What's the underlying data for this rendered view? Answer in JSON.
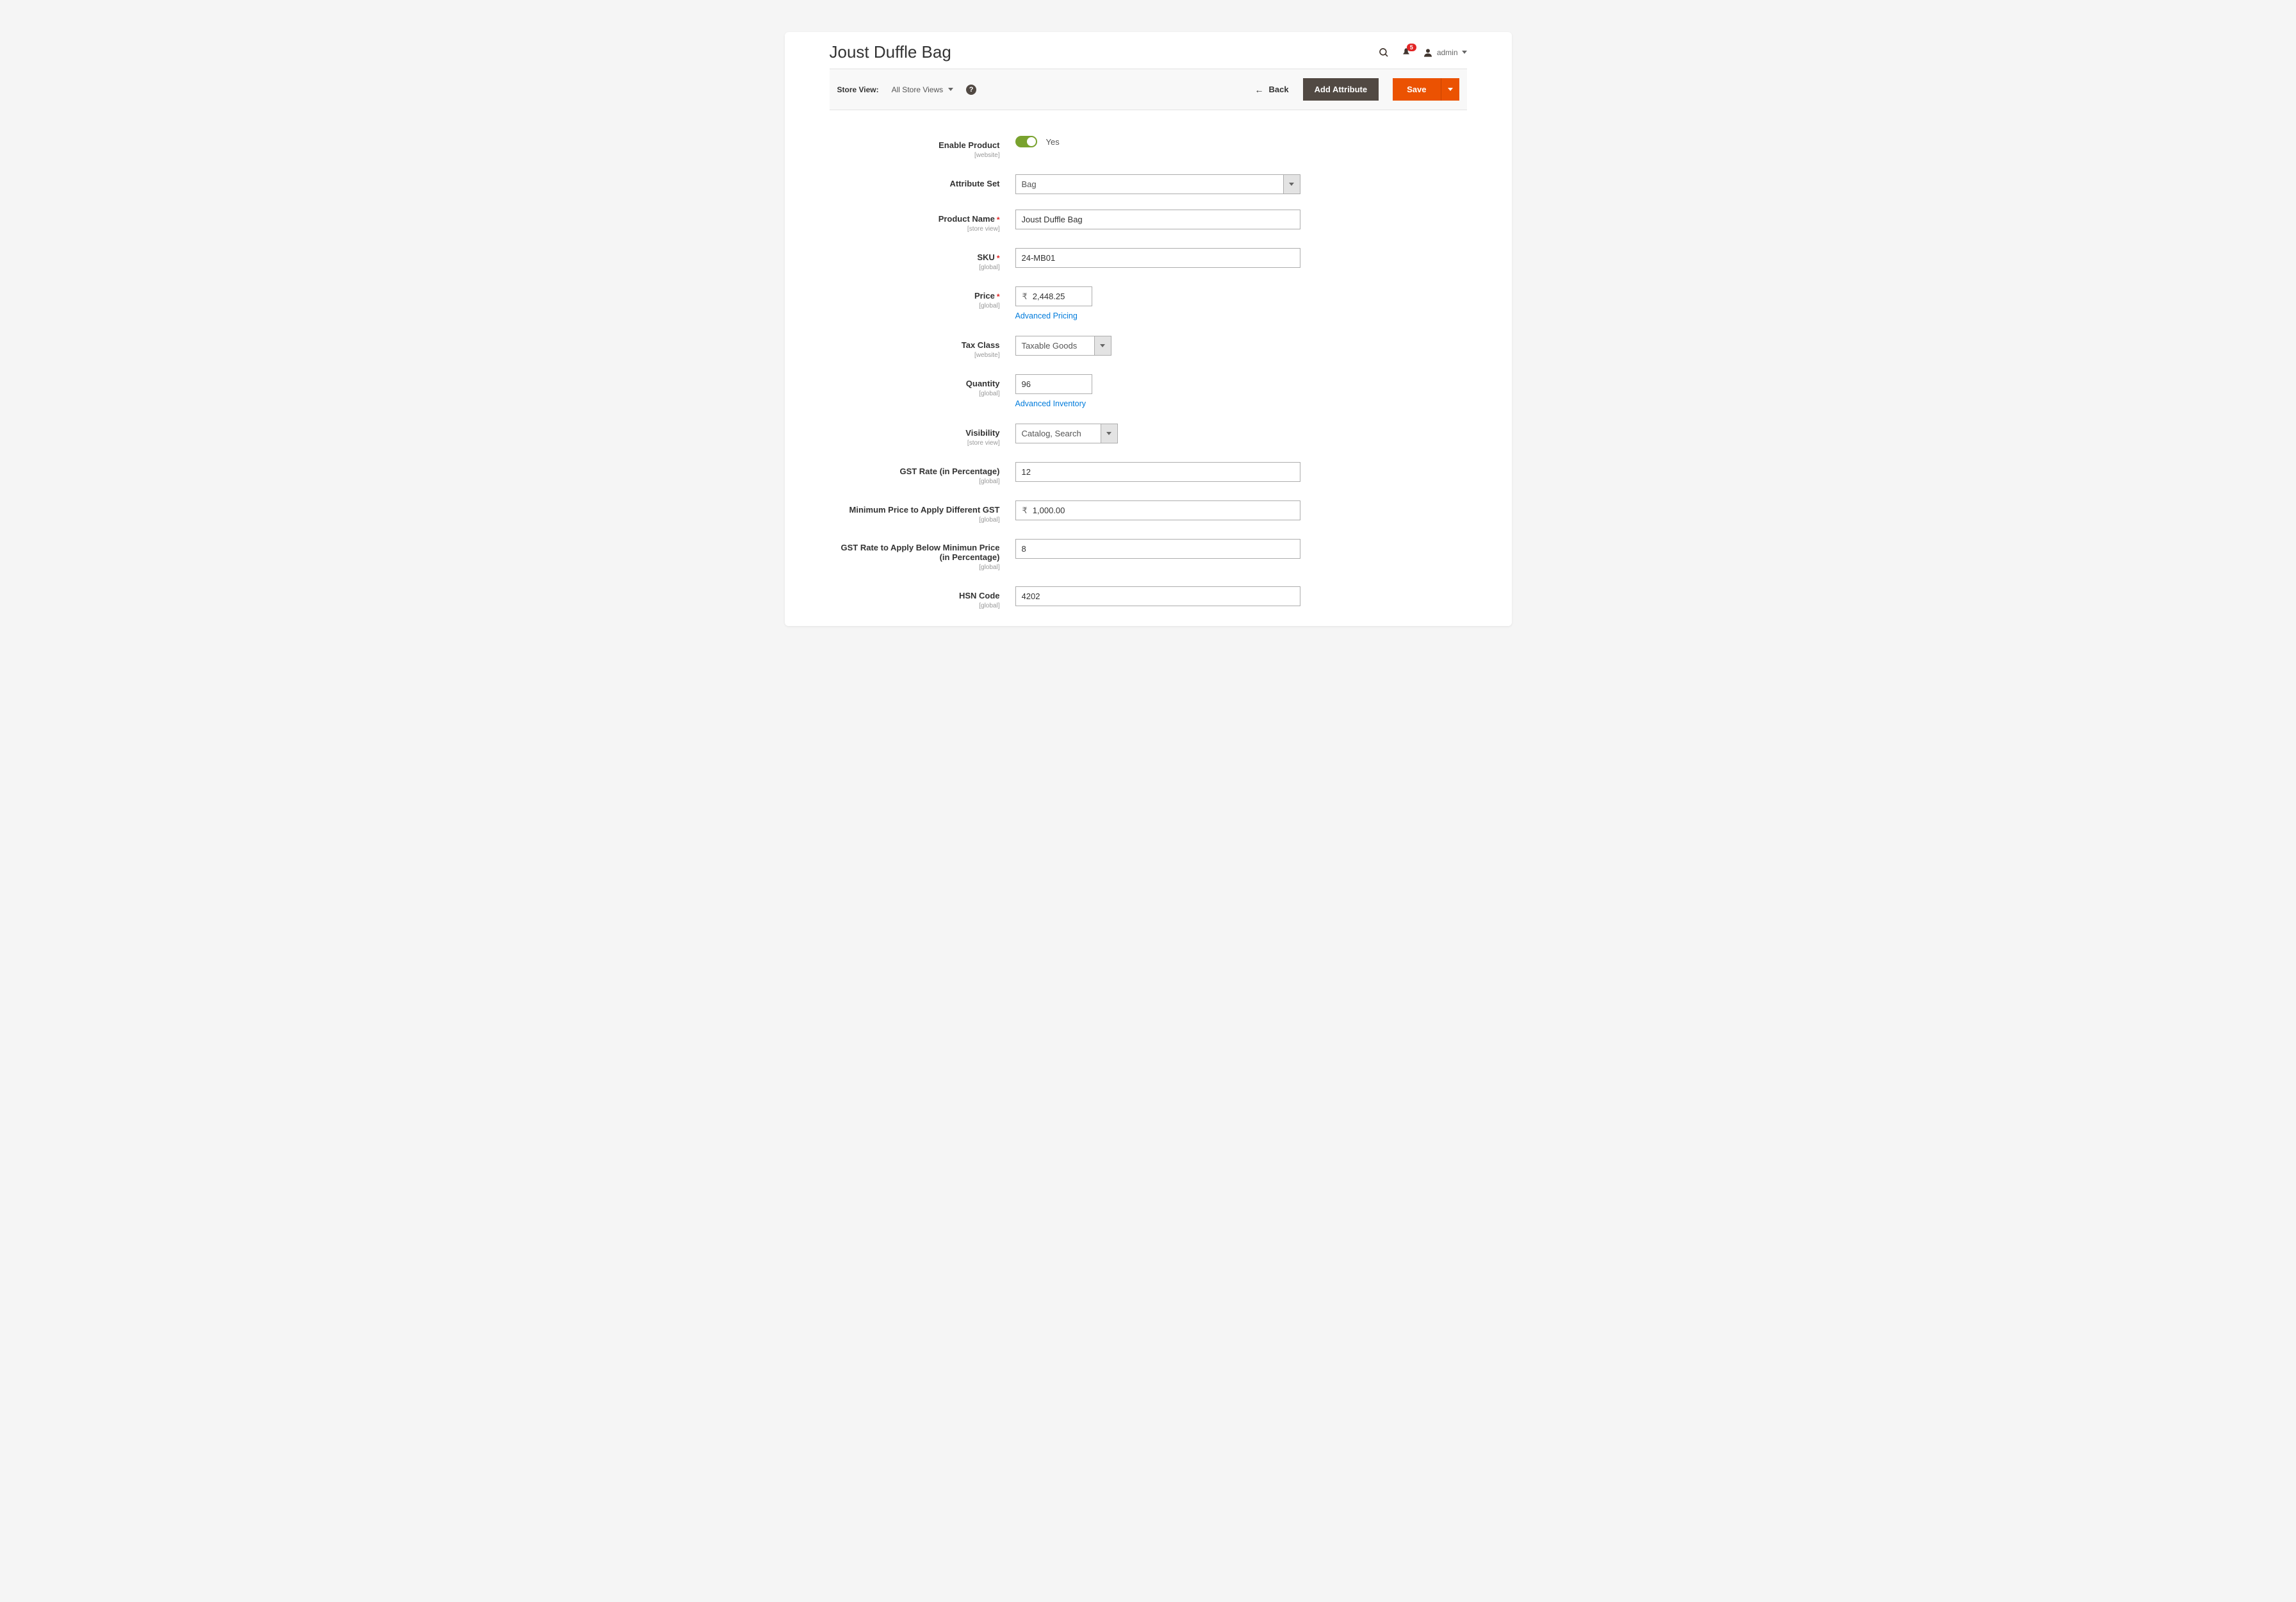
{
  "header": {
    "page_title": "Joust Duffle Bag",
    "user_label": "admin",
    "notifications_count": "5"
  },
  "toolbar": {
    "store_view_label": "Store View:",
    "store_view_value": "All Store Views",
    "back_label": "Back",
    "add_attribute_label": "Add Attribute",
    "save_label": "Save"
  },
  "form": {
    "enable_product": {
      "label": "Enable Product",
      "scope": "[website]",
      "value_text": "Yes"
    },
    "attribute_set": {
      "label": "Attribute Set",
      "value": "Bag"
    },
    "product_name": {
      "label": "Product Name",
      "scope": "[store view]",
      "value": "Joust Duffle Bag"
    },
    "sku": {
      "label": "SKU",
      "scope": "[global]",
      "value": "24-MB01"
    },
    "price": {
      "label": "Price",
      "scope": "[global]",
      "currency": "₹",
      "value": "2,448.25",
      "advanced_link": "Advanced Pricing"
    },
    "tax_class": {
      "label": "Tax Class",
      "scope": "[website]",
      "value": "Taxable Goods"
    },
    "quantity": {
      "label": "Quantity",
      "scope": "[global]",
      "value": "96",
      "advanced_link": "Advanced Inventory"
    },
    "visibility": {
      "label": "Visibility",
      "scope": "[store view]",
      "value": "Catalog, Search"
    },
    "gst_rate": {
      "label": "GST Rate (in Percentage)",
      "scope": "[global]",
      "value": "12"
    },
    "min_price_gst": {
      "label": "Minimum Price to Apply Different GST",
      "scope": "[global]",
      "currency": "₹",
      "value": "1,000.00"
    },
    "gst_rate_below": {
      "label": "GST Rate to Apply Below Minimun Price (in Percentage)",
      "scope": "[global]",
      "value": "8"
    },
    "hsn_code": {
      "label": "HSN Code",
      "scope": "[global]",
      "value": "4202"
    }
  }
}
